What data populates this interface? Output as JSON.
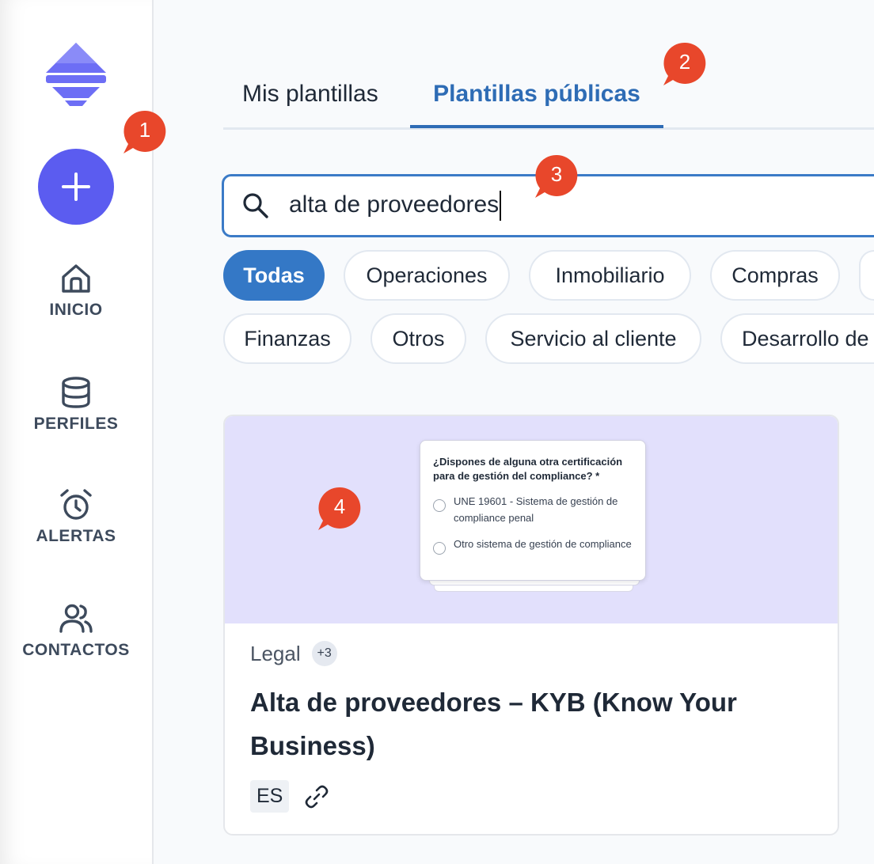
{
  "sidebar": {
    "add_label": "+",
    "items": [
      {
        "label": "INICIO",
        "icon": "home-icon"
      },
      {
        "label": "PERFILES",
        "icon": "database-icon"
      },
      {
        "label": "ALERTAS",
        "icon": "alarm-clock-icon"
      },
      {
        "label": "CONTACTOS",
        "icon": "users-icon"
      }
    ]
  },
  "tabs": [
    {
      "label": "Mis plantillas",
      "active": false
    },
    {
      "label": "Plantillas públicas",
      "active": true
    }
  ],
  "search": {
    "value": "alta de proveedores",
    "icon": "search-icon"
  },
  "filters": {
    "row1": [
      "Todas",
      "Operaciones",
      "Inmobiliario",
      "Compras",
      ""
    ],
    "row2": [
      "Finanzas",
      "Otros",
      "Servicio al cliente",
      "Desarrollo de"
    ]
  },
  "card": {
    "preview": {
      "question": "¿Dispones de alguna otra certificación para de gestión del compliance? *",
      "options": [
        "UNE 19601 - Sistema de gestión de compliance penal",
        "Otro sistema de gestión de compliance"
      ]
    },
    "category": "Legal",
    "category_extra": "+3",
    "title": "Alta de proveedores – KYB (Know Your Business)",
    "language": "ES"
  },
  "markers": [
    "1",
    "2",
    "3",
    "4"
  ],
  "colors": {
    "accent": "#5b5cf0",
    "primary_blue": "#3478c6",
    "marker_red": "#e8472b",
    "preview_bg": "#e2e0fc"
  }
}
